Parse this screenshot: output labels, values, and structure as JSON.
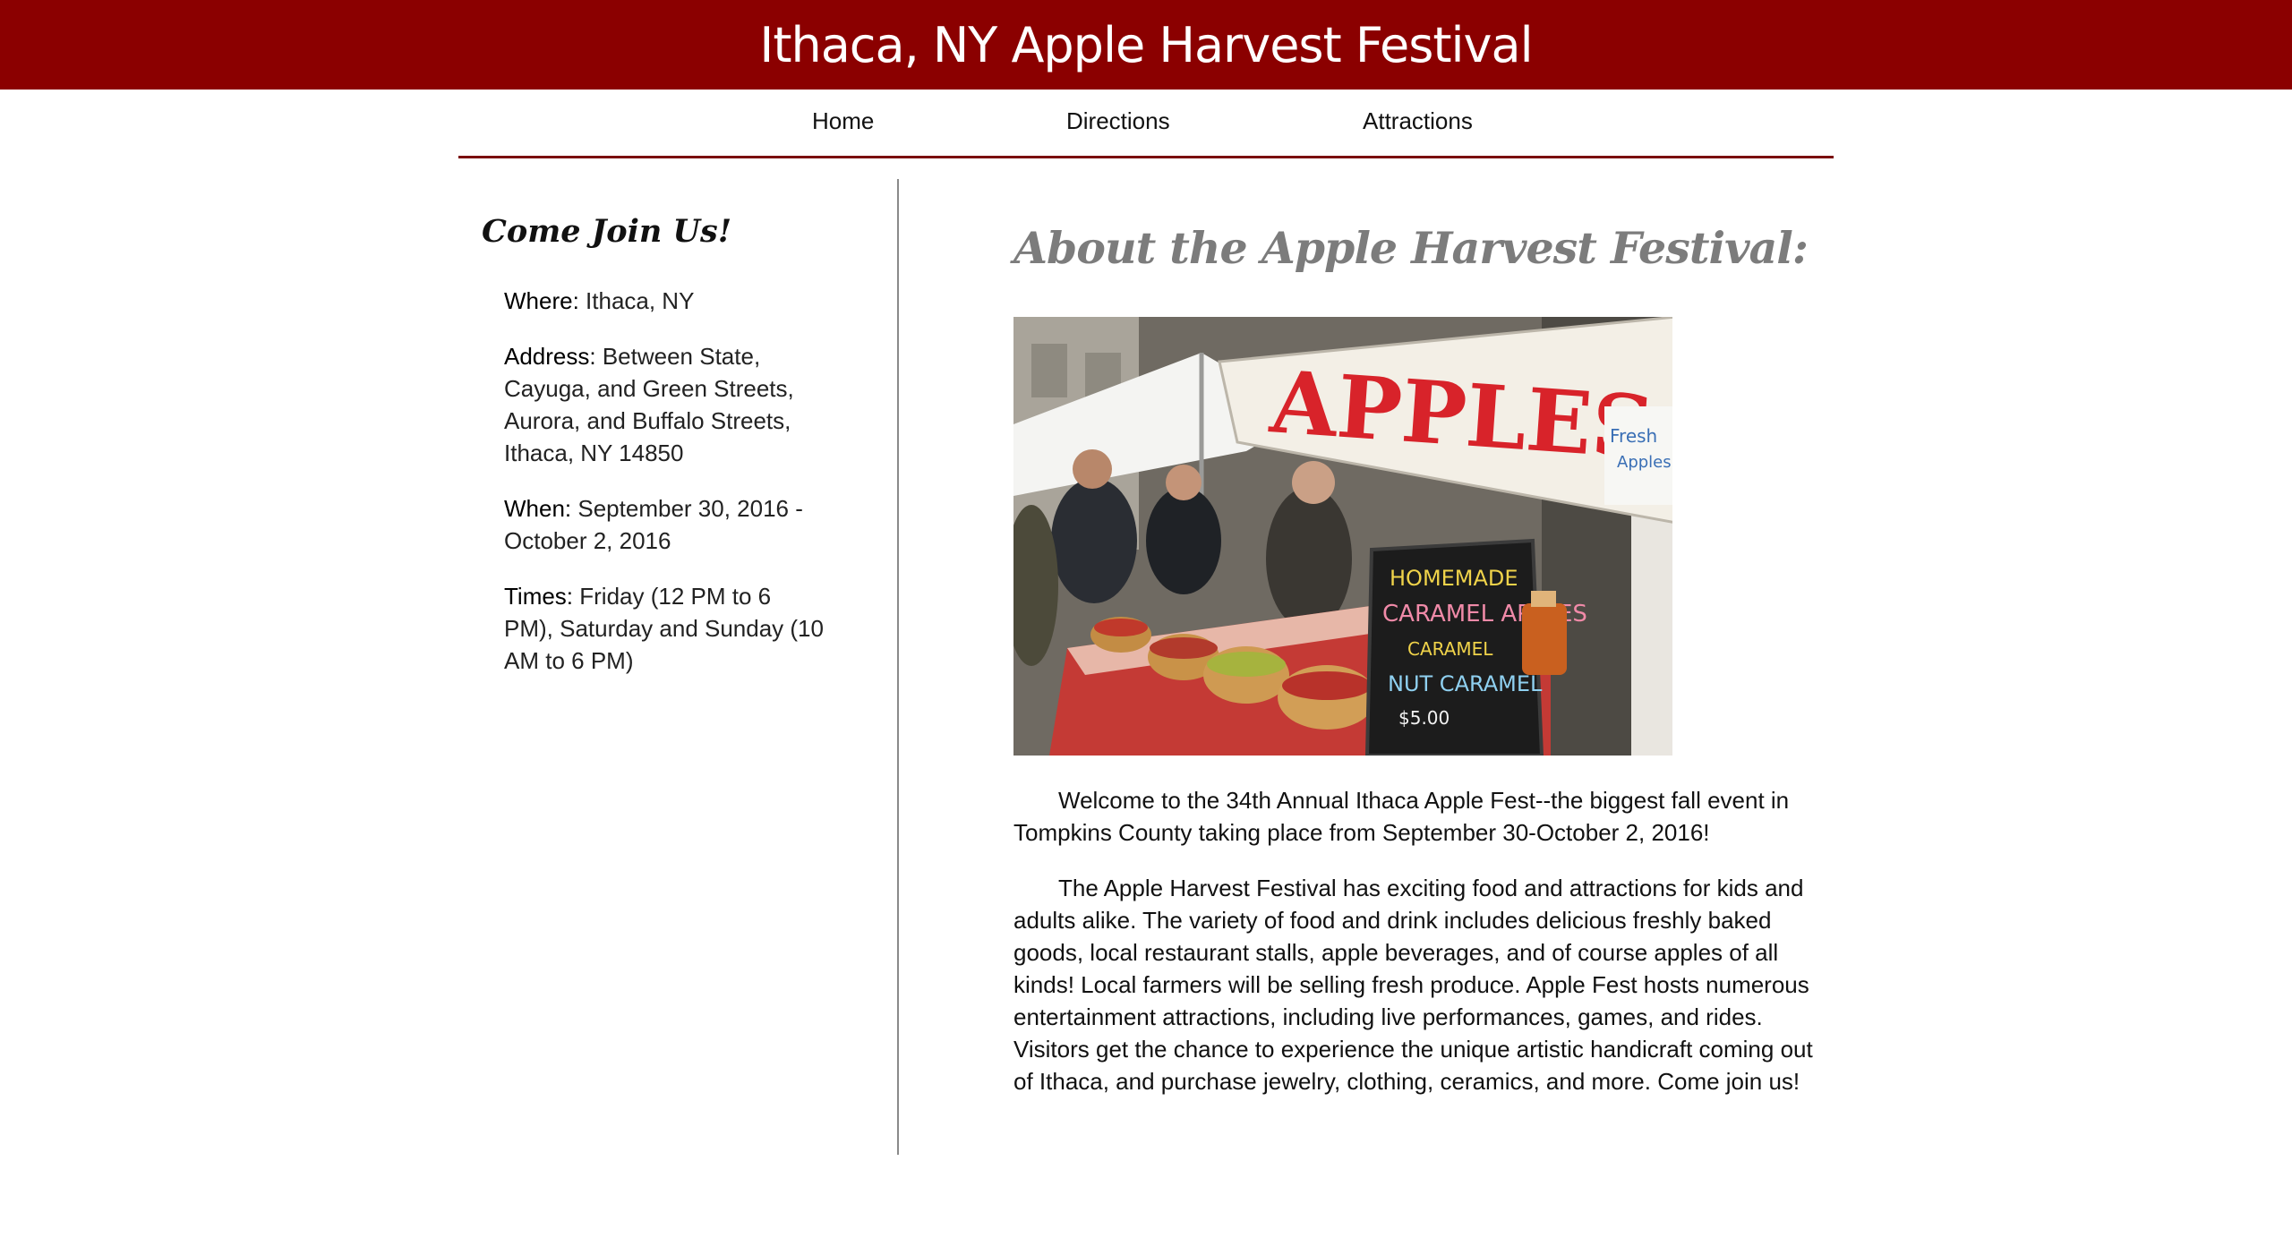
{
  "header": {
    "title": "Ithaca, NY Apple Harvest Festival"
  },
  "nav": {
    "items": [
      {
        "label": "Home"
      },
      {
        "label": "Directions"
      },
      {
        "label": "Attractions"
      }
    ]
  },
  "sidebar": {
    "heading": "Come Join Us!",
    "info": [
      {
        "label": "Where:",
        "value": " Ithaca, NY"
      },
      {
        "label": "Address:",
        "value": " Between State, Cayuga, and Green Streets, Aurora, and Buffalo Streets, Ithaca, NY 14850"
      },
      {
        "label": "When:",
        "value": " September 30, 2016 - October 2, 2016"
      },
      {
        "label": "Times:",
        "value": " Friday (12 PM to 6 PM), Saturday and Sunday (10 AM to 6 PM)"
      }
    ]
  },
  "main": {
    "heading": "About the Apple Harvest Festival:",
    "photo": {
      "sign_text": "APPLES",
      "side_sign_text": "Fresh Apples",
      "chalkboard_lines": [
        "HOMEMADE",
        "CARAMEL APPLES",
        "CARAMEL",
        "NUT CARAMEL"
      ]
    },
    "paragraphs": [
      "Welcome to the 34th Annual Ithaca Apple Fest--the biggest fall event in Tompkins County taking place from September 30-October 2, 2016!",
      "The Apple Harvest Festival has exciting food and attractions for kids and adults alike. The variety of food and drink includes delicious freshly baked goods, local restaurant stalls, apple beverages, and of course apples of all kinds! Local farmers will be selling fresh produce. Apple Fest hosts numerous entertainment attractions, including live performances, games, and rides. Visitors get the chance to experience the unique artistic handicraft coming out of Ithaca, and purchase jewelry, clothing, ceramics, and more. Come join us!"
    ]
  },
  "colors": {
    "banner": "#8b0000",
    "nav_rule": "#7a0c0c",
    "divider": "#8a8a8a",
    "main_heading": "#7c7c7c"
  }
}
